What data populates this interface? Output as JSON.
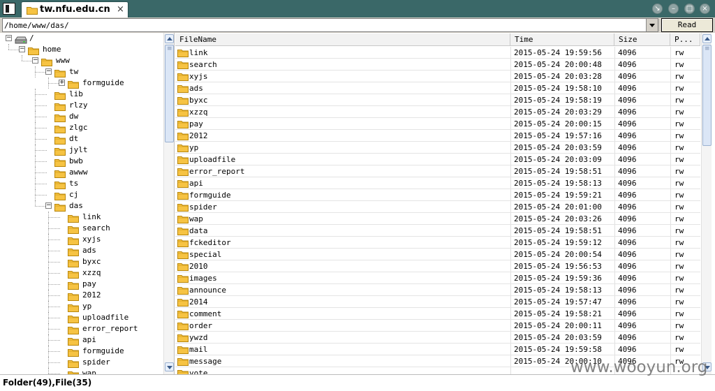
{
  "window": {
    "tab_title": "tw.nfu.edu.cn",
    "tab_close": "×"
  },
  "address": {
    "path": "/home/www/das/",
    "read_label": "Read"
  },
  "tree": [
    {
      "depth": 0,
      "label": "/",
      "icon": "drive-icon",
      "expander": "minus"
    },
    {
      "depth": 1,
      "label": "home",
      "icon": "folder-icon",
      "expander": "minus"
    },
    {
      "depth": 2,
      "label": "www",
      "icon": "folder-icon",
      "expander": "minus"
    },
    {
      "depth": 3,
      "label": "tw",
      "icon": "folder-icon",
      "expander": "minus"
    },
    {
      "depth": 4,
      "label": "formguide",
      "icon": "folder-icon",
      "expander": "plus"
    },
    {
      "depth": 3,
      "label": "lib",
      "icon": "folder-icon",
      "expander": "none"
    },
    {
      "depth": 3,
      "label": "rlzy",
      "icon": "folder-icon",
      "expander": "none"
    },
    {
      "depth": 3,
      "label": "dw",
      "icon": "folder-icon",
      "expander": "none"
    },
    {
      "depth": 3,
      "label": "zlgc",
      "icon": "folder-icon",
      "expander": "none"
    },
    {
      "depth": 3,
      "label": "dt",
      "icon": "folder-icon",
      "expander": "none"
    },
    {
      "depth": 3,
      "label": "jylt",
      "icon": "folder-icon",
      "expander": "none"
    },
    {
      "depth": 3,
      "label": "bwb",
      "icon": "folder-icon",
      "expander": "none"
    },
    {
      "depth": 3,
      "label": "awww",
      "icon": "folder-icon",
      "expander": "none"
    },
    {
      "depth": 3,
      "label": "ts",
      "icon": "folder-icon",
      "expander": "none"
    },
    {
      "depth": 3,
      "label": "cj",
      "icon": "folder-icon",
      "expander": "none"
    },
    {
      "depth": 3,
      "label": "das",
      "icon": "folder-icon",
      "expander": "minus"
    },
    {
      "depth": 4,
      "label": "link",
      "icon": "folder-icon",
      "expander": "none"
    },
    {
      "depth": 4,
      "label": "search",
      "icon": "folder-icon",
      "expander": "none"
    },
    {
      "depth": 4,
      "label": "xyjs",
      "icon": "folder-icon",
      "expander": "none"
    },
    {
      "depth": 4,
      "label": "ads",
      "icon": "folder-icon",
      "expander": "none"
    },
    {
      "depth": 4,
      "label": "byxc",
      "icon": "folder-icon",
      "expander": "none"
    },
    {
      "depth": 4,
      "label": "xzzq",
      "icon": "folder-icon",
      "expander": "none"
    },
    {
      "depth": 4,
      "label": "pay",
      "icon": "folder-icon",
      "expander": "none"
    },
    {
      "depth": 4,
      "label": "2012",
      "icon": "folder-icon",
      "expander": "none"
    },
    {
      "depth": 4,
      "label": "yp",
      "icon": "folder-icon",
      "expander": "none"
    },
    {
      "depth": 4,
      "label": "uploadfile",
      "icon": "folder-icon",
      "expander": "none"
    },
    {
      "depth": 4,
      "label": "error_report",
      "icon": "folder-icon",
      "expander": "none"
    },
    {
      "depth": 4,
      "label": "api",
      "icon": "folder-icon",
      "expander": "none"
    },
    {
      "depth": 4,
      "label": "formguide",
      "icon": "folder-icon",
      "expander": "none"
    },
    {
      "depth": 4,
      "label": "spider",
      "icon": "folder-icon",
      "expander": "none"
    },
    {
      "depth": 4,
      "label": "wap",
      "icon": "folder-icon",
      "expander": "none"
    }
  ],
  "list": {
    "columns": [
      "FileName",
      "Time",
      "Size",
      "P..."
    ],
    "rows": [
      {
        "name": "link",
        "time": "2015-05-24 19:59:56",
        "size": "4096",
        "perm": "rw"
      },
      {
        "name": "search",
        "time": "2015-05-24 20:00:48",
        "size": "4096",
        "perm": "rw"
      },
      {
        "name": "xyjs",
        "time": "2015-05-24 20:03:28",
        "size": "4096",
        "perm": "rw"
      },
      {
        "name": "ads",
        "time": "2015-05-24 19:58:10",
        "size": "4096",
        "perm": "rw"
      },
      {
        "name": "byxc",
        "time": "2015-05-24 19:58:19",
        "size": "4096",
        "perm": "rw"
      },
      {
        "name": "xzzq",
        "time": "2015-05-24 20:03:29",
        "size": "4096",
        "perm": "rw"
      },
      {
        "name": "pay",
        "time": "2015-05-24 20:00:15",
        "size": "4096",
        "perm": "rw"
      },
      {
        "name": "2012",
        "time": "2015-05-24 19:57:16",
        "size": "4096",
        "perm": "rw"
      },
      {
        "name": "yp",
        "time": "2015-05-24 20:03:59",
        "size": "4096",
        "perm": "rw"
      },
      {
        "name": "uploadfile",
        "time": "2015-05-24 20:03:09",
        "size": "4096",
        "perm": "rw"
      },
      {
        "name": "error_report",
        "time": "2015-05-24 19:58:51",
        "size": "4096",
        "perm": "rw"
      },
      {
        "name": "api",
        "time": "2015-05-24 19:58:13",
        "size": "4096",
        "perm": "rw"
      },
      {
        "name": "formguide",
        "time": "2015-05-24 19:59:21",
        "size": "4096",
        "perm": "rw"
      },
      {
        "name": "spider",
        "time": "2015-05-24 20:01:00",
        "size": "4096",
        "perm": "rw"
      },
      {
        "name": "wap",
        "time": "2015-05-24 20:03:26",
        "size": "4096",
        "perm": "rw"
      },
      {
        "name": "data",
        "time": "2015-05-24 19:58:51",
        "size": "4096",
        "perm": "rw"
      },
      {
        "name": "fckeditor",
        "time": "2015-05-24 19:59:12",
        "size": "4096",
        "perm": "rw"
      },
      {
        "name": "special",
        "time": "2015-05-24 20:00:54",
        "size": "4096",
        "perm": "rw"
      },
      {
        "name": "2010",
        "time": "2015-05-24 19:56:53",
        "size": "4096",
        "perm": "rw"
      },
      {
        "name": "images",
        "time": "2015-05-24 19:59:36",
        "size": "4096",
        "perm": "rw"
      },
      {
        "name": "announce",
        "time": "2015-05-24 19:58:13",
        "size": "4096",
        "perm": "rw"
      },
      {
        "name": "2014",
        "time": "2015-05-24 19:57:47",
        "size": "4096",
        "perm": "rw"
      },
      {
        "name": "comment",
        "time": "2015-05-24 19:58:21",
        "size": "4096",
        "perm": "rw"
      },
      {
        "name": "order",
        "time": "2015-05-24 20:00:11",
        "size": "4096",
        "perm": "rw"
      },
      {
        "name": "ywzd",
        "time": "2015-05-24 20:03:59",
        "size": "4096",
        "perm": "rw"
      },
      {
        "name": "mail",
        "time": "2015-05-24 19:59:58",
        "size": "4096",
        "perm": "rw"
      },
      {
        "name": "message",
        "time": "2015-05-24 20:00:10",
        "size": "4096",
        "perm": "rw"
      },
      {
        "name": "vote",
        "time": "",
        "size": "",
        "perm": ""
      }
    ]
  },
  "status": {
    "text": "Folder(49),File(35)"
  },
  "watermark": "www.wooyun.org",
  "colors": {
    "titlebar": "#3a6868",
    "folder": "#f6c343"
  }
}
